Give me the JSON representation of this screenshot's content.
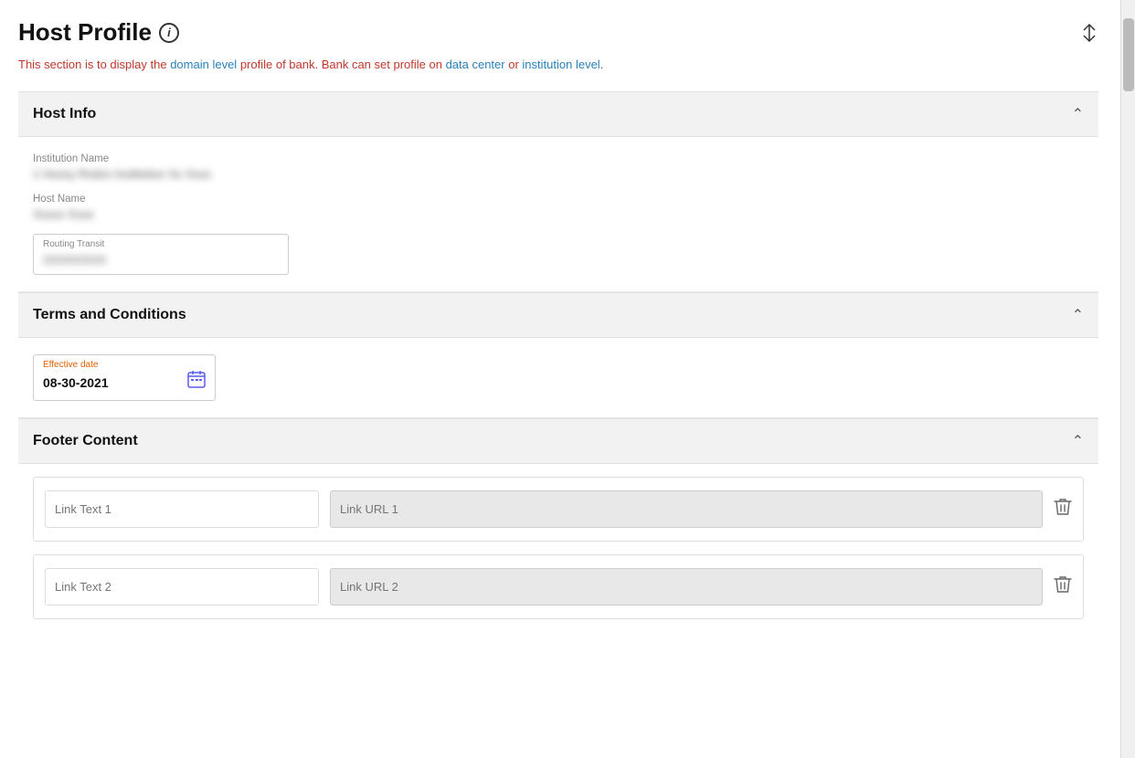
{
  "page": {
    "title": "Host Profile",
    "info_icon_label": "i",
    "subtitle": "This section is to display the domain level profile of bank. Bank can set profile on data center or institution level."
  },
  "sections": {
    "host_info": {
      "title": "Host Info",
      "institution_name_label": "Institution Name",
      "institution_name_value": "[ blurred institution name ]",
      "host_name_label": "Host Name",
      "host_name_value": "[ blurred host ]",
      "routing_transit_label": "Routing Transit",
      "routing_transit_value": "[ blurred ]"
    },
    "terms_and_conditions": {
      "title": "Terms and Conditions",
      "effective_date_label": "Effective date",
      "effective_date_value": "08-30-2021"
    },
    "footer_content": {
      "title": "Footer Content",
      "rows": [
        {
          "link_text_placeholder": "Link Text 1",
          "link_url_placeholder": "Link URL 1"
        },
        {
          "link_text_placeholder": "Link Text 2",
          "link_url_placeholder": "Link URL 2"
        }
      ]
    }
  },
  "icons": {
    "chevron_up": "∧",
    "calendar": "📅",
    "trash": "🗑",
    "collapse_arrows": "⇅"
  }
}
